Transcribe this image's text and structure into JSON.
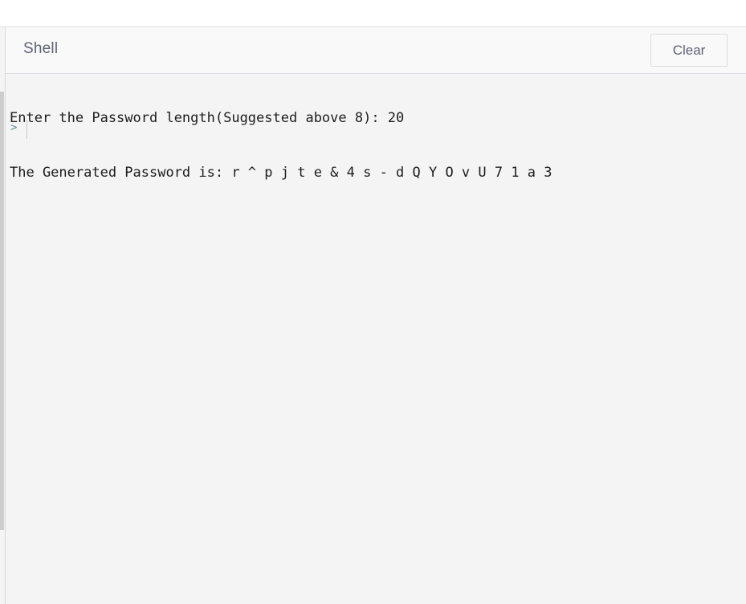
{
  "shell": {
    "title": "Shell",
    "clear_label": "Clear"
  },
  "console": {
    "lines": [
      "Enter the Password length(Suggested above 8): 20",
      "The Generated Password is: r ^ p j t e & 4 s - d Q Y O v U 7 1 a 3"
    ],
    "prompt": ">"
  }
}
